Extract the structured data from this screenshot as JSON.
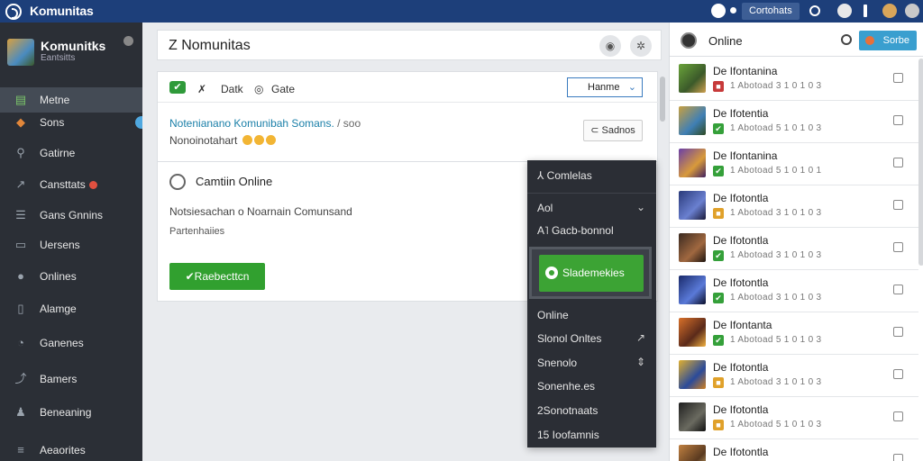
{
  "topbar": {
    "app_title": "Komunitas",
    "button_label": "Cortohats"
  },
  "sidebar": {
    "profile_name": "Komunitks",
    "profile_sub": "Eantsitts",
    "items": [
      {
        "label": "Metne",
        "icon": "layers-icon",
        "active": true
      },
      {
        "label": "Sons",
        "icon": "flame-icon"
      },
      {
        "label": "Gatirne",
        "icon": "search-icon"
      },
      {
        "label": "Cansttats",
        "icon": "trend-icon",
        "badge": true
      },
      {
        "label": "Gans Gnnins",
        "icon": "list-icon"
      },
      {
        "label": "Uersens",
        "icon": "inbox-icon"
      },
      {
        "label": "Onlines",
        "icon": "circle-icon"
      },
      {
        "label": "Alamge",
        "icon": "bookmark-icon"
      },
      {
        "label": "Ganenes",
        "icon": "clock-icon"
      },
      {
        "label": "Bamers",
        "icon": "share-icon"
      },
      {
        "label": "Beneaning",
        "icon": "user-icon"
      },
      {
        "label": "Aeaorites",
        "icon": "stack-icon"
      }
    ]
  },
  "main": {
    "page_title": "Z Nomunitas",
    "compose": {
      "tool_1": "Datk",
      "tool_2": "Gate",
      "select_label": "Hanme",
      "link_text": "Notenianano Komunibah Somans.",
      "link_suffix": "/ soo",
      "body_text": "Nonoinotahart",
      "action_button": "Sadnos"
    },
    "online_card": {
      "title": "Camtiin Online",
      "text": "Notsiesachan o Noarnain Comunsand",
      "subtext": "Partenhaiies",
      "button": "✔Raebecttcn"
    }
  },
  "dropdown": {
    "header": "Comlelas",
    "item_1": "Aol",
    "item_2": "Gacb-bonnol",
    "highlight": "Slademekies",
    "item_3": "Online",
    "item_4": "Slonol Onltes",
    "item_5": "Snenolo",
    "item_6": "Sonenhe.es",
    "item_7": "2Sonotnaats",
    "item_8": "15 Ioofamnis"
  },
  "rpanel": {
    "title": "Online",
    "button": "Sorbe",
    "members": [
      {
        "name": "De Ifontanina",
        "meta": "1 Abotoad 3 1 0 1 0 3",
        "badge": "red"
      },
      {
        "name": "De Ifotentia",
        "meta": "1 Abotoad 5 1 0 1 0 3",
        "badge": "green"
      },
      {
        "name": "De Ifontanina",
        "meta": "1 Abotoad 5 1 0 1 0 1",
        "badge": "green"
      },
      {
        "name": "De Ifotontla",
        "meta": "1 Abotoad 3 1 0 1 0 3",
        "badge": "yellow"
      },
      {
        "name": "De Ifotontla",
        "meta": "1 Abotoad 3 1 0 1 0 3",
        "badge": "green"
      },
      {
        "name": "De Ifotontla",
        "meta": "1 Abotoad 3 1 0 1 0 3",
        "badge": "green"
      },
      {
        "name": "De Ifontanta",
        "meta": "1 Abotoad 5 1 0 1 0 3",
        "badge": "green"
      },
      {
        "name": "De Ifotontla",
        "meta": "1 Abotoad 3 1 0 1 0 3",
        "badge": "yellow"
      },
      {
        "name": "De Ifotontla",
        "meta": "1 Abotoad 5 1 0 1 0 3",
        "badge": "yellow"
      },
      {
        "name": "De Ifotontla",
        "meta": "",
        "badge": ""
      }
    ]
  }
}
